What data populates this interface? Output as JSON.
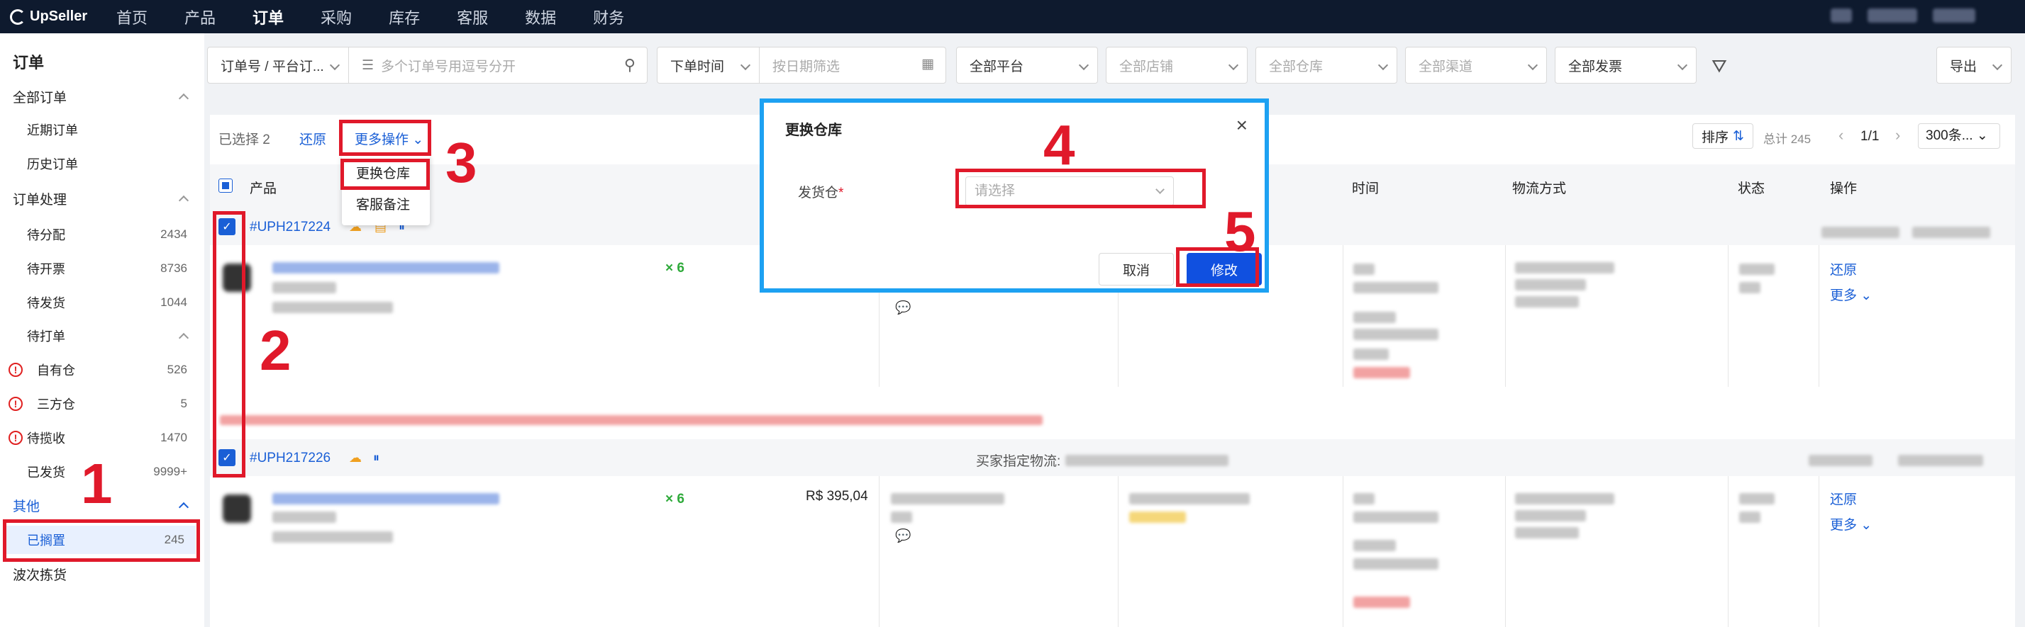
{
  "brand": "UpSeller",
  "nav": [
    "首页",
    "产品",
    "订单",
    "采购",
    "库存",
    "客服",
    "数据",
    "财务"
  ],
  "nav_active": "订单",
  "sidebar": {
    "title": "订单",
    "all_orders": "全部订单",
    "recent": "近期订单",
    "history": "历史订单",
    "processing": "订单处理",
    "to_assign": {
      "label": "待分配",
      "count": "2434"
    },
    "to_invoice": {
      "label": "待开票",
      "count": "8736"
    },
    "to_ship": {
      "label": "待发货",
      "count": "1044"
    },
    "to_print": "待打单",
    "own_wh": {
      "label": "自有仓",
      "count": "526"
    },
    "third_wh": {
      "label": "三方仓",
      "count": "5"
    },
    "to_pickup": {
      "label": "待揽收",
      "count": "1470"
    },
    "shipped": {
      "label": "已发货",
      "count": "9999+"
    },
    "other": "其他",
    "on_hold": {
      "label": "已搁置",
      "count": "245"
    },
    "wave_pick": "波次拣货"
  },
  "filters": {
    "order_type": "订单号 / 平台订...",
    "search_placeholder": "多个订单号用逗号分开",
    "time_type": "下单时间",
    "date_placeholder": "按日期筛选",
    "platform": "全部平台",
    "shop": "全部店铺",
    "warehouse": "全部仓库",
    "channel": "全部渠道",
    "invoice": "全部发票",
    "export": "导出"
  },
  "toolbar": {
    "selected": "已选择 2",
    "restore": "还原",
    "more_ops": "更多操作",
    "sort": "排序",
    "total": "总计 245",
    "page": "1/1",
    "per_page": "300条..."
  },
  "menu": [
    "更换仓库",
    "客服备注"
  ],
  "table_headers": {
    "product": "产品",
    "time": "时间",
    "shipping": "物流方式",
    "status": "状态",
    "actions": "操作"
  },
  "orders": [
    {
      "id": "#UPH217224",
      "qty": "× 6",
      "restore": "还原",
      "more": "更多"
    },
    {
      "id": "#UPH217226",
      "qty": "× 6",
      "price": "R$ 395,04",
      "buyer_logistics": "买家指定物流:",
      "restore": "还原",
      "more": "更多"
    }
  ],
  "modal": {
    "title": "更换仓库",
    "field_label": "发货仓",
    "required_mark": "*",
    "placeholder": "请选择",
    "cancel": "取消",
    "confirm": "修改"
  },
  "annotations": [
    "1",
    "2",
    "3",
    "4",
    "5"
  ],
  "colors": {
    "nav_bg": "#0e1a2e",
    "primary": "#1a5fd6",
    "annotation": "#e0192a",
    "modal_border": "#1da1f2"
  }
}
